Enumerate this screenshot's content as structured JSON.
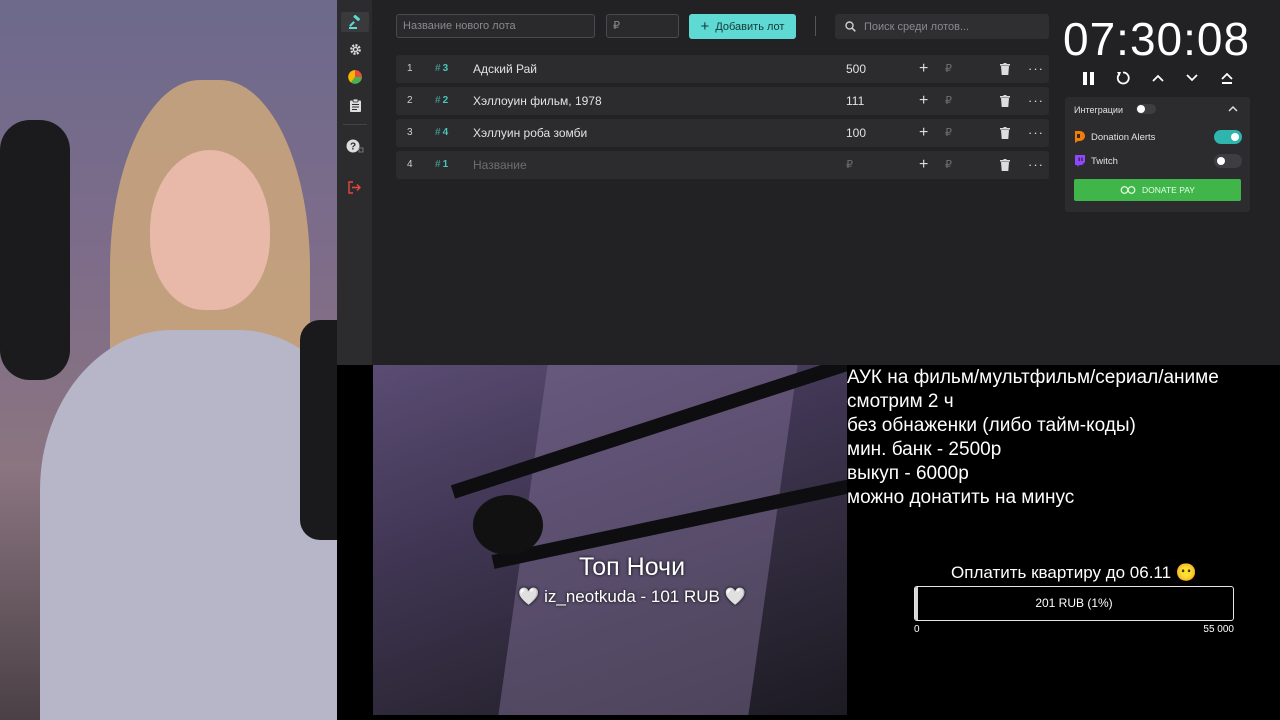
{
  "app": {
    "new_lot_placeholder": "Название нового лота",
    "amount_placeholder": "₽",
    "add_lot_label": "Добавить лот",
    "search_placeholder": "Поиск среди лотов..."
  },
  "sidebar": {
    "items": [
      {
        "icon": "gavel-icon",
        "active": true
      },
      {
        "icon": "gear-icon"
      },
      {
        "icon": "pie-chart-icon"
      },
      {
        "icon": "clipboard-icon"
      },
      {
        "icon": "help-icon"
      },
      {
        "icon": "logout-icon",
        "color": "#e5483e"
      }
    ]
  },
  "lots": [
    {
      "index": "1",
      "id": "3",
      "name": "Адский Рай",
      "amount": "500",
      "currency": "₽"
    },
    {
      "index": "2",
      "id": "2",
      "name": "Хэллоуин фильм, 1978",
      "amount": "111",
      "currency": "₽"
    },
    {
      "index": "3",
      "id": "4",
      "name": "Хэллуин роба зомби",
      "amount": "100",
      "currency": "₽"
    },
    {
      "index": "4",
      "id": "1",
      "name": "Название",
      "amount": "₽",
      "currency": "₽"
    }
  ],
  "timer": {
    "value": "07:30:08",
    "controls": [
      "pause-icon",
      "restart-icon",
      "chevron-up-icon",
      "chevron-down-icon",
      "eject-icon"
    ]
  },
  "integrations": {
    "title": "Интеграции",
    "items": [
      {
        "name": "Donation Alerts",
        "enabled": true,
        "icon": "donationalerts-icon",
        "color": "#f57d07"
      },
      {
        "name": "Twitch",
        "enabled": false,
        "icon": "twitch-icon",
        "color": "#9146ff"
      }
    ],
    "donate_pay_label": "DONATE PAY",
    "donate_pay_color": "#3fb54a"
  },
  "top_night": {
    "title": "Топ Ночи",
    "entry": "🤍 iz_neotkuda - 101 RUB 🤍"
  },
  "rules": [
    "АУК на фильм/мультфильм/сериал/аниме",
    "смотрим 2 ч",
    "без обнаженки (либо тайм-коды)",
    "мин. банк - 2500р",
    "выкуп - 6000р",
    "можно донатить на минус"
  ],
  "goal": {
    "title": "Оплатить квартиру до 06.11 😶",
    "progress_text": "201 RUB (1%)",
    "progress_fraction": 0.01,
    "min_label": "0",
    "max_label": "55 000"
  },
  "colors": {
    "accent": "#5fd9d3",
    "panel": "#2c2c2e",
    "background": "#222224"
  }
}
